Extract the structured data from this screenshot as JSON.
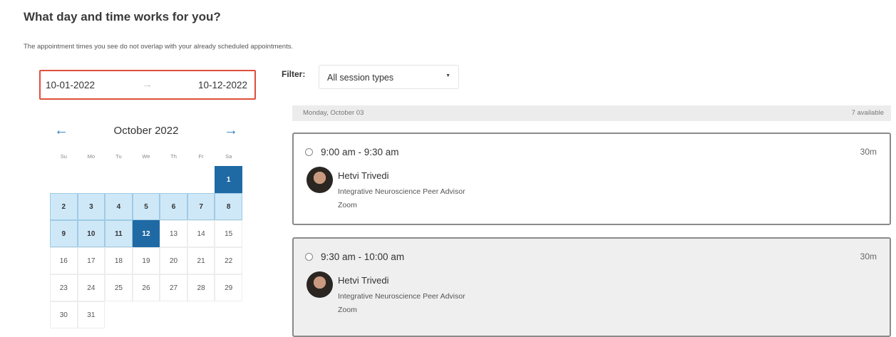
{
  "page": {
    "title": "What day and time works for you?",
    "subtitle": "The appointment times you see do not overlap with your already scheduled appointments."
  },
  "date_range": {
    "start": "10-01-2022",
    "arrow": "→",
    "end": "10-12-2022"
  },
  "calendar": {
    "prev_icon": "←",
    "next_icon": "→",
    "month": "October 2022",
    "weekdays": [
      "Su",
      "Mo",
      "Tu",
      "We",
      "Th",
      "Fr",
      "Sa"
    ],
    "weeks": [
      [
        null,
        null,
        null,
        null,
        null,
        null,
        {
          "d": "1",
          "s": "selected"
        }
      ],
      [
        {
          "d": "2",
          "s": "inrange"
        },
        {
          "d": "3",
          "s": "inrange"
        },
        {
          "d": "4",
          "s": "inrange"
        },
        {
          "d": "5",
          "s": "inrange"
        },
        {
          "d": "6",
          "s": "inrange"
        },
        {
          "d": "7",
          "s": "inrange"
        },
        {
          "d": "8",
          "s": "inrange"
        }
      ],
      [
        {
          "d": "9",
          "s": "inrange"
        },
        {
          "d": "10",
          "s": "inrange"
        },
        {
          "d": "11",
          "s": "inrange"
        },
        {
          "d": "12",
          "s": "selected"
        },
        {
          "d": "13",
          "s": ""
        },
        {
          "d": "14",
          "s": ""
        },
        {
          "d": "15",
          "s": ""
        }
      ],
      [
        {
          "d": "16",
          "s": ""
        },
        {
          "d": "17",
          "s": ""
        },
        {
          "d": "18",
          "s": ""
        },
        {
          "d": "19",
          "s": ""
        },
        {
          "d": "20",
          "s": ""
        },
        {
          "d": "21",
          "s": ""
        },
        {
          "d": "22",
          "s": ""
        }
      ],
      [
        {
          "d": "23",
          "s": ""
        },
        {
          "d": "24",
          "s": ""
        },
        {
          "d": "25",
          "s": ""
        },
        {
          "d": "26",
          "s": ""
        },
        {
          "d": "27",
          "s": ""
        },
        {
          "d": "28",
          "s": ""
        },
        {
          "d": "29",
          "s": ""
        }
      ],
      [
        {
          "d": "30",
          "s": ""
        },
        {
          "d": "31",
          "s": ""
        },
        null,
        null,
        null,
        null,
        null
      ]
    ]
  },
  "filter": {
    "label": "Filter:",
    "value": "All session types",
    "caret": "▼"
  },
  "day_header": {
    "date": "Monday, October 03",
    "available": "7 available"
  },
  "slots": [
    {
      "time": "9:00 am - 9:30 am",
      "duration": "30m",
      "name": "Hetvi Trivedi",
      "role": "Integrative Neuroscience Peer Advisor",
      "location": "Zoom"
    },
    {
      "time": "9:30 am - 10:00 am",
      "duration": "30m",
      "name": "Hetvi Trivedi",
      "role": "Integrative Neuroscience Peer Advisor",
      "location": "Zoom"
    }
  ],
  "colors": {
    "accent": "#1f6aa5",
    "range_fill": "#cfe8f7",
    "highlight_border": "#e0503a",
    "link": "#2d7cc1"
  },
  "icons": {
    "radio": "radio-unchecked-icon",
    "arrow_left": "arrow-left-icon",
    "arrow_right": "arrow-right-icon",
    "dropdown": "caret-down-icon"
  }
}
